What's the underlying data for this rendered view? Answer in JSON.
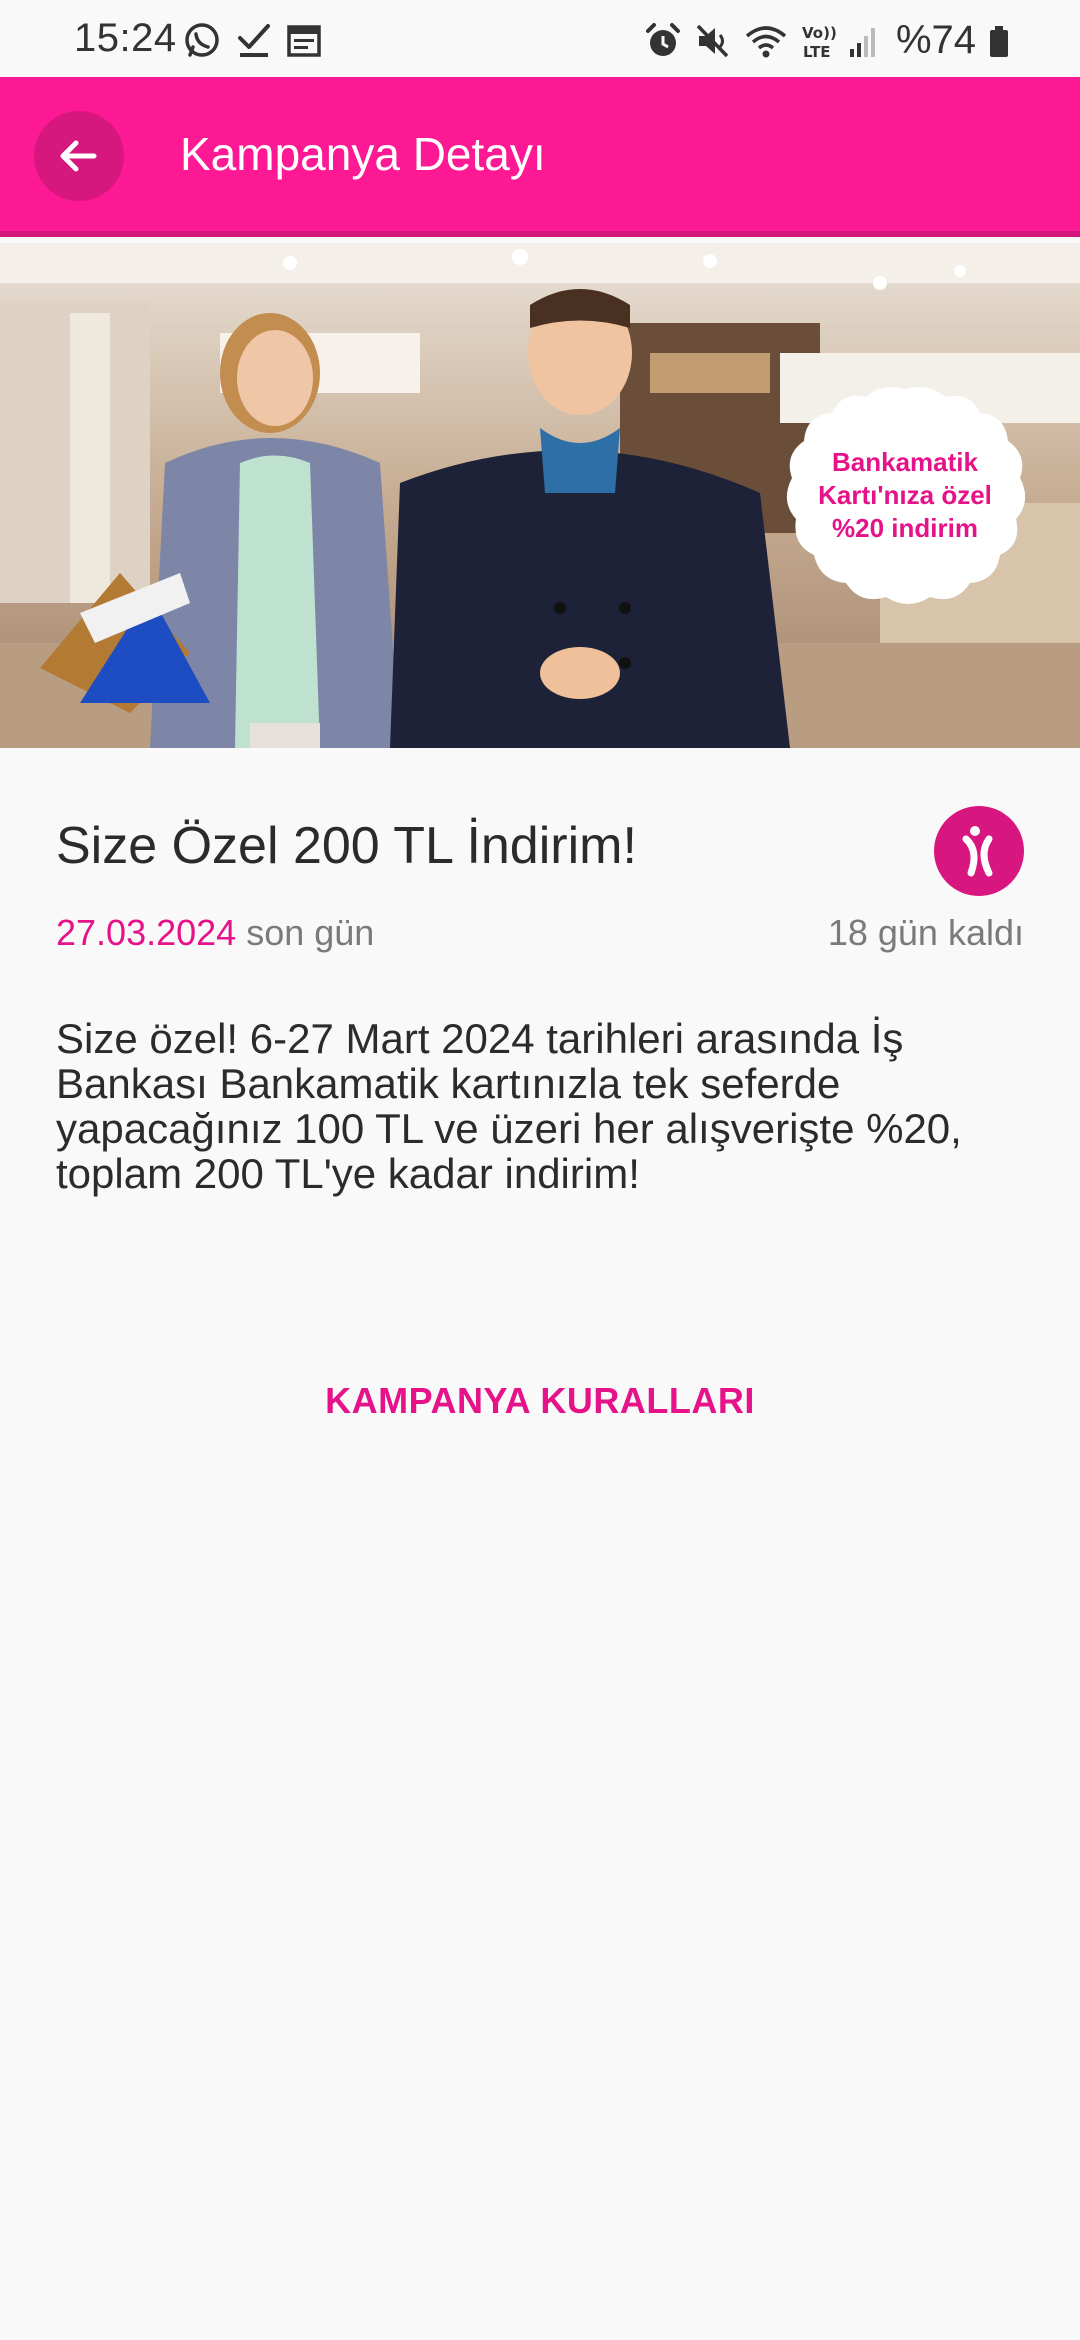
{
  "status_bar": {
    "time": "15:24",
    "battery": "%74",
    "icons": [
      "whatsapp-icon",
      "checkmark-icon",
      "calendar-icon",
      "alarm-icon",
      "mute-icon",
      "wifi-icon",
      "volte-icon",
      "signal-icon",
      "battery-icon"
    ]
  },
  "app_bar": {
    "title": "Kampanya Detayı",
    "back_icon": "arrow-left-icon"
  },
  "banner": {
    "badge_line1": "Bankamatik",
    "badge_line2": "Kartı'nıza özel",
    "badge_line3": "%20 indirim"
  },
  "campaign": {
    "title": "Size Özel 200 TL İndirim!",
    "end_date": "27.03.2024",
    "end_date_suffix": "son gün",
    "days_left": "18 gün kaldı",
    "description": "Size özel! 6-27 Mart 2024 tarihleri arasında İş Bankası Bankamatik kartınızla tek seferde yapacağınız 100 TL ve üzeri her alışverişte %20, toplam 200 TL'ye kadar indirim!",
    "rules_label": "KAMPANYA KURALLARI"
  },
  "colors": {
    "brand_pink": "#fd1994",
    "accent_pink": "#e5128a"
  }
}
